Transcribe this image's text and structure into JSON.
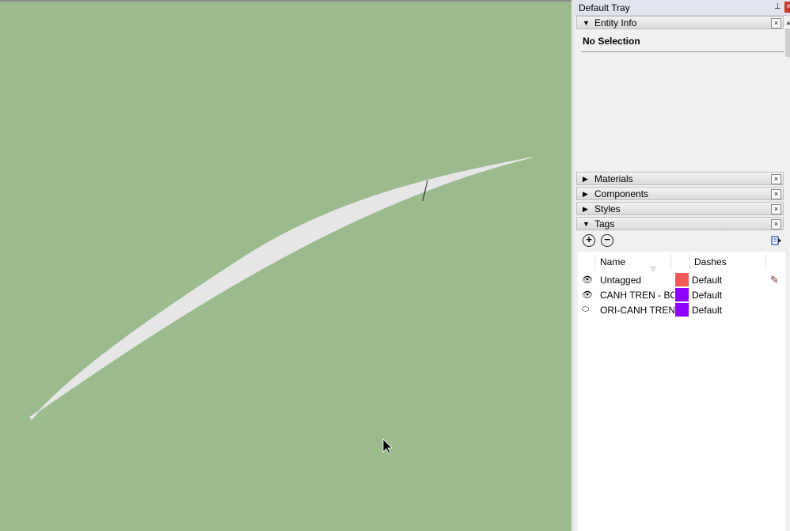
{
  "tray": {
    "title": "Default Tray",
    "pin_glyph": "⊥",
    "close_glyph": "×"
  },
  "panels": {
    "entity_info": {
      "label": "Entity Info",
      "expanded": true,
      "arrow": "▼",
      "close": "×"
    },
    "materials": {
      "label": "Materials",
      "expanded": false,
      "arrow": "▶",
      "close": "×"
    },
    "components": {
      "label": "Components",
      "expanded": false,
      "arrow": "▶",
      "close": "×"
    },
    "styles": {
      "label": "Styles",
      "expanded": false,
      "arrow": "▶",
      "close": "×"
    },
    "tags": {
      "label": "Tags",
      "expanded": true,
      "arrow": "▼",
      "close": "×"
    }
  },
  "entity_info": {
    "selection_text": "No Selection"
  },
  "tags": {
    "add_glyph": "+",
    "remove_glyph": "−",
    "columns": {
      "name": "Name",
      "dashes": "Dashes"
    },
    "sort_glyph": "▽",
    "rows": [
      {
        "visible": true,
        "vis_glyph": "👁",
        "name": "Untagged",
        "color": "#f25a5a",
        "dashes": "Default",
        "active": true,
        "pencil": "✎"
      },
      {
        "visible": true,
        "vis_glyph": "👁",
        "name": "CANH TREN - BONE",
        "color": "#8b00ff",
        "dashes": "Default",
        "active": false
      },
      {
        "visible": false,
        "vis_glyph": "⬭",
        "name": "ORI-CANH TREN",
        "color": "#8b00ff",
        "dashes": "Default",
        "active": false
      }
    ]
  },
  "viewport": {
    "background": "#9bbb8f",
    "shape_fill": "#e6e6e6",
    "cursor_icon": "arrow-cursor-icon"
  }
}
